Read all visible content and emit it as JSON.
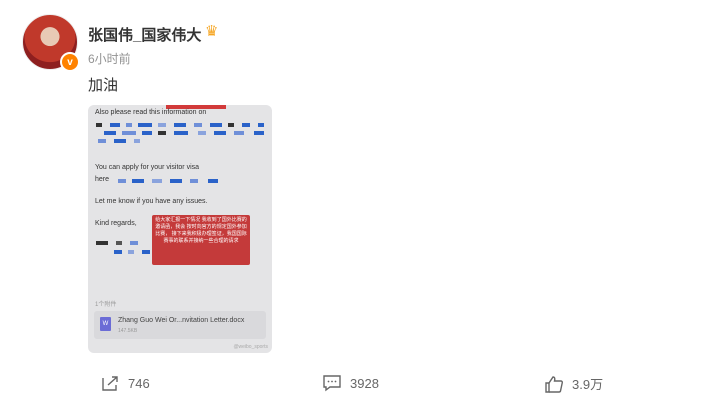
{
  "post": {
    "username": "张国伟_国家伟大",
    "time": "6小时前",
    "text": "加油",
    "avatar_badge": "v"
  },
  "image": {
    "lines": {
      "l1": "Also please read this information on",
      "l2": "You can apply for your visitor visa",
      "l3": "here",
      "l4": "Let me know if you have any issues.",
      "l5": "Kind regards,"
    },
    "overlay_text": "给大家汇报一下情况 我收到了国外比赛的邀请函，我会 按时向官方的规定国外参加比赛， 接下来我积极办理签证，我国国际 赛事的联系并接纳一些合理的请求",
    "attachment_count": "1个附件",
    "attachment_name": "Zhang Guo Wei Or...nvitation Letter.docx",
    "attachment_size": "147.5KB",
    "watermark": "@weibo_sports"
  },
  "actions": {
    "share_count": "746",
    "comment_count": "3928",
    "like_count": "3.9万"
  }
}
